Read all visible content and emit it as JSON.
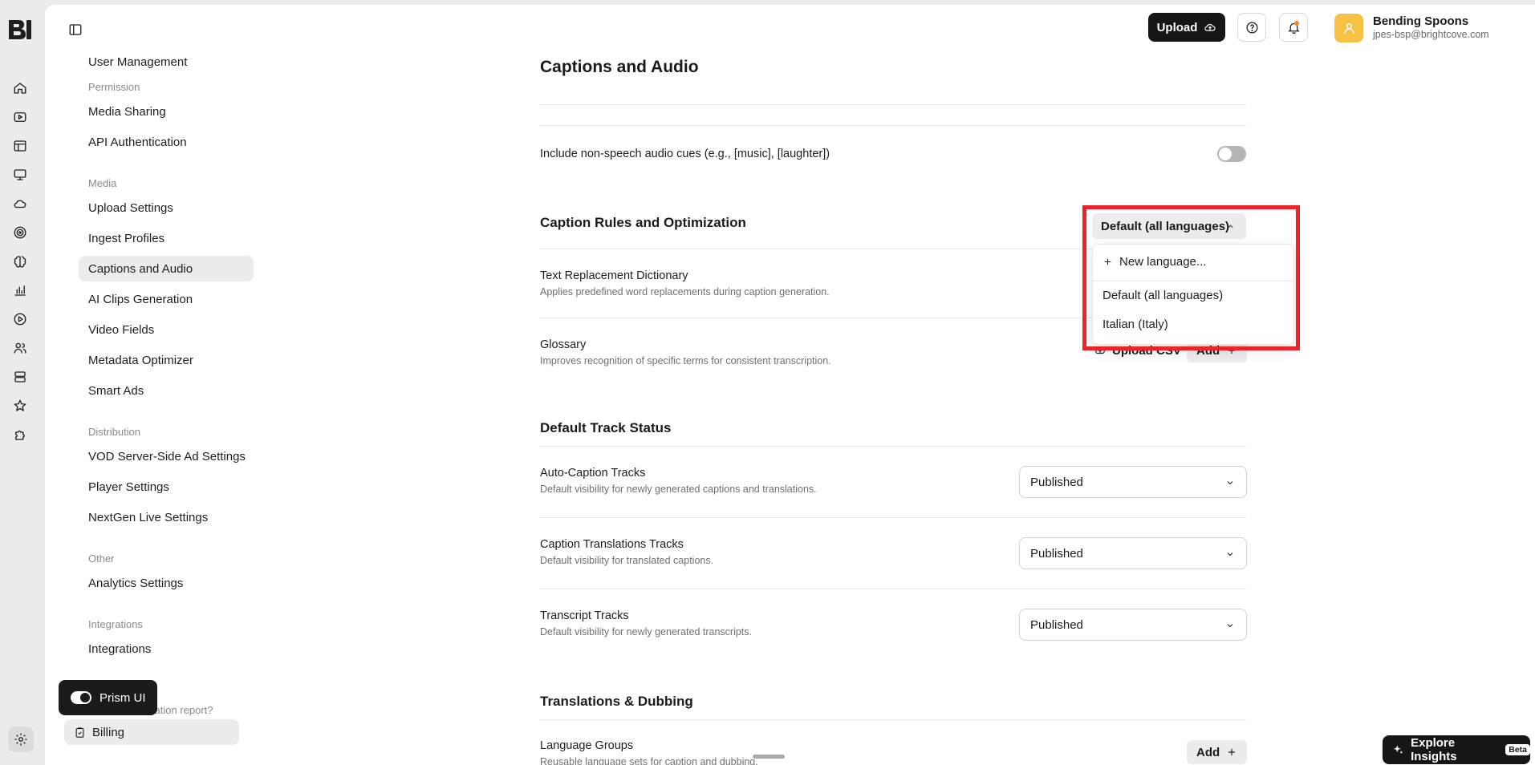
{
  "header": {
    "upload_label": "Upload",
    "account_name": "Bending Spoons",
    "account_email": "jpes-bsp@brightcove.com"
  },
  "rail_icons": [
    "home-icon",
    "video-icon",
    "layout-icon",
    "monitor-icon",
    "cloud-icon",
    "target-icon",
    "brain-icon",
    "chart-icon",
    "play-circle-icon",
    "users-icon",
    "server-icon",
    "star-icon",
    "puzzle-icon",
    "gear-icon"
  ],
  "settings_nav": {
    "groups": {
      "permission": "Permission",
      "media": "Media",
      "distribution": "Distribution",
      "other": "Other",
      "integrations": "Integrations"
    },
    "items": {
      "user_management": "User Management",
      "media_sharing": "Media Sharing",
      "api_auth": "API Authentication",
      "upload_settings": "Upload Settings",
      "ingest_profiles": "Ingest Profiles",
      "captions_audio": "Captions and Audio",
      "ai_clips": "AI Clips Generation",
      "video_fields": "Video Fields",
      "metadata_optimizer": "Metadata Optimizer",
      "smart_ads": "Smart Ads",
      "vod_ssai": "VOD Server-Side Ad Settings",
      "player_settings": "Player Settings",
      "nextgen_live": "NextGen Live Settings",
      "analytics_settings": "Analytics Settings",
      "integrations": "Integrations",
      "billing": "Billing"
    },
    "prism_label": "Prism UI",
    "prism_trailing_text": "zation report?"
  },
  "content": {
    "page_title": "Captions and Audio",
    "nonspeech_label": "Include non-speech audio cues (e.g., [music], [laughter])",
    "caption_rules": {
      "title": "Caption Rules and Optimization",
      "language_selector": "Default (all languages)",
      "text_replacement_title": "Text Replacement Dictionary",
      "text_replacement_sub": "Applies predefined word replacements during caption generation.",
      "glossary_title": "Glossary",
      "glossary_sub": "Improves recognition of specific terms for consistent transcription.",
      "upload_csv": "Upload CSV",
      "add": "Add"
    },
    "language_menu": {
      "new_language": "New language...",
      "options": [
        "Default (all languages)",
        "Italian (Italy)"
      ]
    },
    "default_track": {
      "title": "Default Track Status",
      "rows": [
        {
          "title": "Auto-Caption Tracks",
          "sub": "Default visibility for newly generated captions and translations.",
          "value": "Published"
        },
        {
          "title": "Caption Translations Tracks",
          "sub": "Default visibility for translated captions.",
          "value": "Published"
        },
        {
          "title": "Transcript Tracks",
          "sub": "Default visibility for newly generated transcripts.",
          "value": "Published"
        }
      ]
    },
    "translations": {
      "title": "Translations & Dubbing",
      "language_groups_title": "Language Groups",
      "language_groups_sub": "Reusable language sets for caption and dubbing.",
      "add": "Add"
    }
  },
  "explore": {
    "label": "Explore Insights",
    "badge": "Beta"
  },
  "colors": {
    "highlight": "#ee2227",
    "primary_button": "#161616",
    "avatar": "#f7c244",
    "active_nav": "#ececec"
  }
}
